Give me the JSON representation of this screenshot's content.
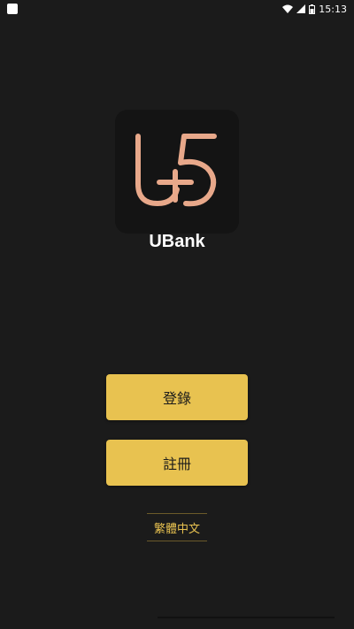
{
  "status_bar": {
    "time": "15:13"
  },
  "app": {
    "name": "UBank"
  },
  "buttons": {
    "login_label": "登錄",
    "register_label": "註冊"
  },
  "language": {
    "label": "繁體中文"
  },
  "colors": {
    "background": "#1b1b1b",
    "accent": "#e8c250",
    "logo": "#e8a88a"
  }
}
